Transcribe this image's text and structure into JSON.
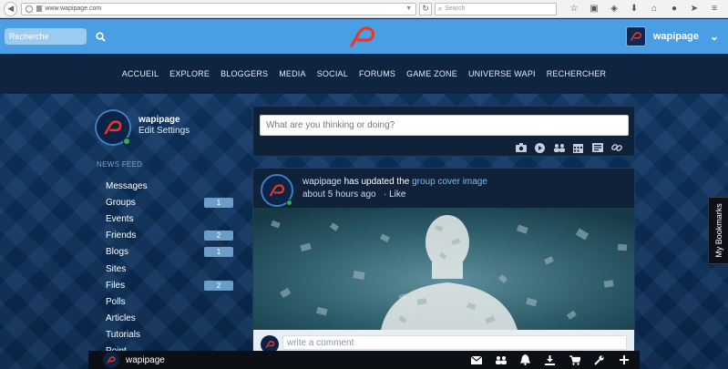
{
  "browser": {
    "url": "www.wapipage.com",
    "search_placeholder": "Search",
    "toolbar_icons": [
      "star-icon",
      "clipboard-icon",
      "pocket-icon",
      "download-icon",
      "home-icon",
      "chat-icon",
      "send-icon",
      "menu-icon"
    ]
  },
  "header": {
    "search_placeholder": "Recherche",
    "username": "wapipage",
    "brand_color": "#4a9ee4",
    "logo_color": "#e8382a"
  },
  "nav": {
    "items": [
      "ACCUEIL",
      "EXPLORE",
      "BLOGGERS",
      "MEDIA",
      "SOCIAL",
      "FORUMS",
      "GAME ZONE",
      "UNIVERSE WAPI",
      "RECHERCHER"
    ]
  },
  "sidebar": {
    "name": "wapipage",
    "edit_settings": "Edit Settings",
    "heading": "NEWS FEED",
    "items": [
      {
        "label": "Messages",
        "count": ""
      },
      {
        "label": "Groups",
        "count": "1"
      },
      {
        "label": "Events",
        "count": ""
      },
      {
        "label": "Friends",
        "count": "2"
      },
      {
        "label": "Blogs",
        "count": "1"
      },
      {
        "label": "Sites",
        "count": ""
      },
      {
        "label": "Files",
        "count": "2"
      },
      {
        "label": "Polls",
        "count": ""
      },
      {
        "label": "Articles",
        "count": ""
      },
      {
        "label": "Tutorials",
        "count": ""
      },
      {
        "label": "Point",
        "count": ""
      }
    ]
  },
  "composer": {
    "placeholder": "What are you thinking or doing?",
    "tools": [
      "camera-icon",
      "play-icon",
      "group-icon",
      "calendar-icon",
      "list-icon",
      "link-icon"
    ]
  },
  "post": {
    "user": "wapipage",
    "action": " has updated the ",
    "link": "group cover image",
    "time": "about 5 hours ago",
    "like": "Like",
    "comment_placeholder": "write a comment"
  },
  "bookmarks": {
    "label": "My Bookmarks"
  },
  "bottom_bar": {
    "username": "wapipage",
    "icons": [
      "mail-icon",
      "friends-icon",
      "bell-icon",
      "download-icon",
      "cart-icon",
      "wrench-icon",
      "plus-icon"
    ]
  }
}
